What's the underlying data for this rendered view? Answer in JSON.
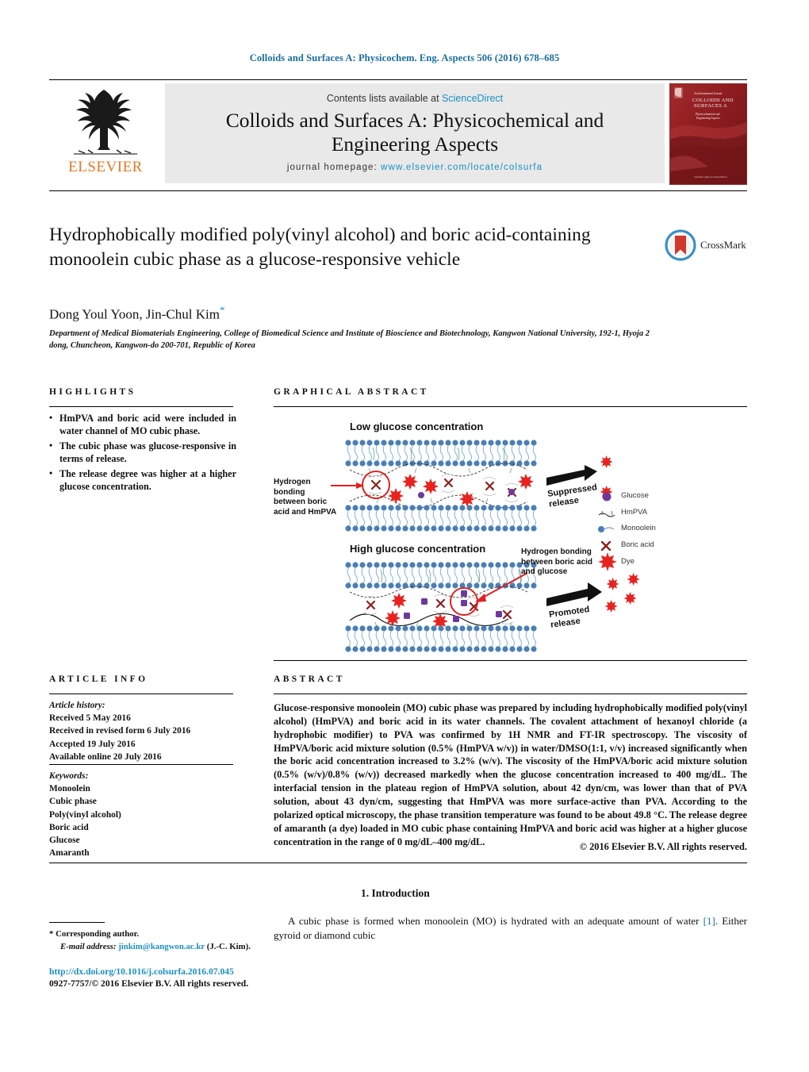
{
  "running_head": "Colloids and Surfaces A: Physicochem. Eng. Aspects 506 (2016) 678–685",
  "masthead": {
    "publisher": "ELSEVIER",
    "contents_prefix": "Contents lists available at ",
    "contents_link": "ScienceDirect",
    "journal_title": "Colloids and Surfaces A: Physicochemical and Engineering Aspects",
    "homepage_prefix": "journal homepage:",
    "homepage_url": "www.elsevier.com/locate/colsurfa",
    "cover_line1": "An International Journal",
    "cover_line2": "COLLOIDS AND SURFACES A",
    "cover_line3": "Physicochemical and Engineering Aspects"
  },
  "article": {
    "title": "Hydrophobically modified poly(vinyl alcohol) and boric acid-containing monoolein cubic phase as a glucose-responsive vehicle",
    "authors": "Dong Youl Yoon, Jin-Chul Kim",
    "author_star": "*",
    "affiliation": "Department of Medical Biomaterials Engineering, College of Biomedical Science and Institute of Bioscience and Biotechnology, Kangwon National University, 192-1, Hyoja 2 dong, Chuncheon, Kangwon-do 200-701, Republic of Korea",
    "crossmark_label": "CrossMark"
  },
  "highlights": {
    "heading": "HIGHLIGHTS",
    "items": [
      "HmPVA and boric acid were included in water channel of MO cubic phase.",
      "The cubic phase was glucose-responsive in terms of release.",
      "The release degree was higher at a higher glucose concentration."
    ]
  },
  "graphical_abstract": {
    "heading": "GRAPHICAL ABSTRACT",
    "panel_top_title": "Low glucose concentration",
    "panel_bottom_title": "High glucose concentration",
    "annotation_top": "Hydrogen bonding between boric acid and HmPVA",
    "annotation_bottom": "Hydrogen bonding between boric acid and glucose",
    "arrow_label_top": "Suppressed release",
    "arrow_label_bottom": "Promoted release",
    "legend": [
      {
        "icon": "glucose-icon",
        "label": "Glucose",
        "color": "#7b3fa0"
      },
      {
        "icon": "hmpva-icon",
        "label": "HmPVA",
        "color": "#2f7d32"
      },
      {
        "icon": "monoolein-icon",
        "label": "Monoolein",
        "color": "#4a7fb5"
      },
      {
        "icon": "boric-acid-icon",
        "label": "Boric acid",
        "color": "#8b2020"
      },
      {
        "icon": "dye-icon",
        "label": "Dye",
        "color": "#e8231f"
      }
    ]
  },
  "article_info": {
    "heading": "ARTICLE INFO",
    "history_label": "Article history:",
    "history": [
      "Received 5 May 2016",
      "Received in revised form 6 July 2016",
      "Accepted 19 July 2016",
      "Available online 20 July 2016"
    ],
    "keywords_label": "Keywords:",
    "keywords": [
      "Monoolein",
      "Cubic phase",
      "Poly(vinyl alcohol)",
      "Boric acid",
      "Glucose",
      "Amaranth"
    ]
  },
  "abstract": {
    "heading": "ABSTRACT",
    "body": "Glucose-responsive monoolein (MO) cubic phase was prepared by including hydrophobically modified poly(vinyl alcohol) (HmPVA) and boric acid in its water channels. The covalent attachment of hexanoyl chloride (a hydrophobic modifier) to PVA was confirmed by 1H NMR and FT-IR spectroscopy. The viscosity of HmPVA/boric acid mixture solution (0.5% (HmPVA w/v)) in water/DMSO(1:1, v/v) increased significantly when the boric acid concentration increased to 3.2% (w/v). The viscosity of the HmPVA/boric acid mixture solution (0.5% (w/v)/0.8% (w/v)) decreased markedly when the glucose concentration increased to 400 mg/dL. The interfacial tension in the plateau region of HmPVA solution, about 42 dyn/cm, was lower than that of PVA solution, about 43 dyn/cm, suggesting that HmPVA was more surface-active than PVA. According to the polarized optical microscopy, the phase transition temperature was found to be about 49.8 °C. The release degree of amaranth (a dye) loaded in MO cubic phase containing HmPVA and boric acid was higher at a higher glucose concentration in the range of 0 mg/dL–400 mg/dL.",
    "rights": "© 2016 Elsevier B.V. All rights reserved."
  },
  "introduction": {
    "heading": "1. Introduction",
    "paragraph_pre": "A cubic phase is formed when monoolein (MO) is hydrated with an adequate amount of water ",
    "reference": "[1]",
    "paragraph_post": ". Either gyroid or diamond cubic"
  },
  "footer": {
    "corresponding_marker": "*",
    "corresponding_label": "Corresponding author.",
    "email_label": "E-mail address:",
    "email": "jinkim@kangwon.ac.kr",
    "email_suffix": "(J.-C. Kim).",
    "doi": "http://dx.doi.org/10.1016/j.colsurfa.2016.07.045",
    "issn": "0927-7757/© 2016 Elsevier B.V. All rights reserved."
  },
  "colors": {
    "link_blue": "#1a8fc1",
    "header_blue": "#1a6d9e",
    "elsevier_orange": "#E87722",
    "banner_gray": "#e9e9e9",
    "cover_red": "#8e1e20"
  }
}
